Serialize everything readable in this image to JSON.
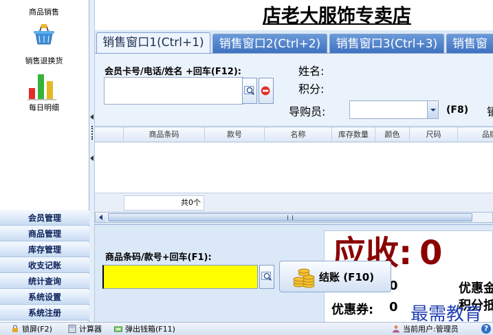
{
  "sidebar": {
    "tools": [
      {
        "label": "商品销售",
        "icon": "sales-icon"
      },
      {
        "label": "销售退换货",
        "icon": "basket-return-icon"
      },
      {
        "label": "每日明细",
        "icon": "bar-chart-icon"
      }
    ],
    "menu": [
      "会员管理",
      "商品管理",
      "库存管理",
      "收支记账",
      "统计查询",
      "系统设置",
      "系统注册"
    ]
  },
  "header": {
    "store_title": "店老大服饰专卖店"
  },
  "tabs": [
    "销售窗口1(Ctrl+1)",
    "销售窗口2(Ctrl+2)",
    "销售窗口3(Ctrl+3)",
    "销售窗"
  ],
  "member": {
    "card_label": "会员卡号/电话/姓名 +回车(F12):",
    "card_value": "",
    "name_label": "姓名:",
    "points_label": "积分:",
    "guide_label": "导购员:",
    "guide_value": "",
    "guide_shortcut": "(F8)",
    "truncated_label": "销"
  },
  "grid": {
    "columns": [
      "",
      "商品条码",
      "款号",
      "名称",
      "库存数量",
      "颜色",
      "尺码",
      "品牌"
    ],
    "rows": [],
    "total_count": "共0个"
  },
  "checkout": {
    "barcode_label": "商品条码/款号+回车(F1):",
    "barcode_value": "",
    "checkout_button": "结账 (F10)",
    "due_label": "应收:",
    "due_value": "0",
    "partial_zero": "0",
    "discount_label": "优惠",
    "discount_cut": "优惠金",
    "coupon_label": "优惠券:",
    "coupon_value": "0",
    "extra_label": "积分抵"
  },
  "watermark": "最需教育",
  "statusbar": {
    "lock": "锁屏(F2)",
    "calculator": "计算器",
    "cash_drawer": "弹出钱箱(F11)",
    "current_user": "当前用户:管理员"
  },
  "colors": {
    "due_red": "#8b0000",
    "barcode_yellow": "#ffff00",
    "tab_blue": "#3f72c0",
    "menu_navy": "#0b2259"
  }
}
